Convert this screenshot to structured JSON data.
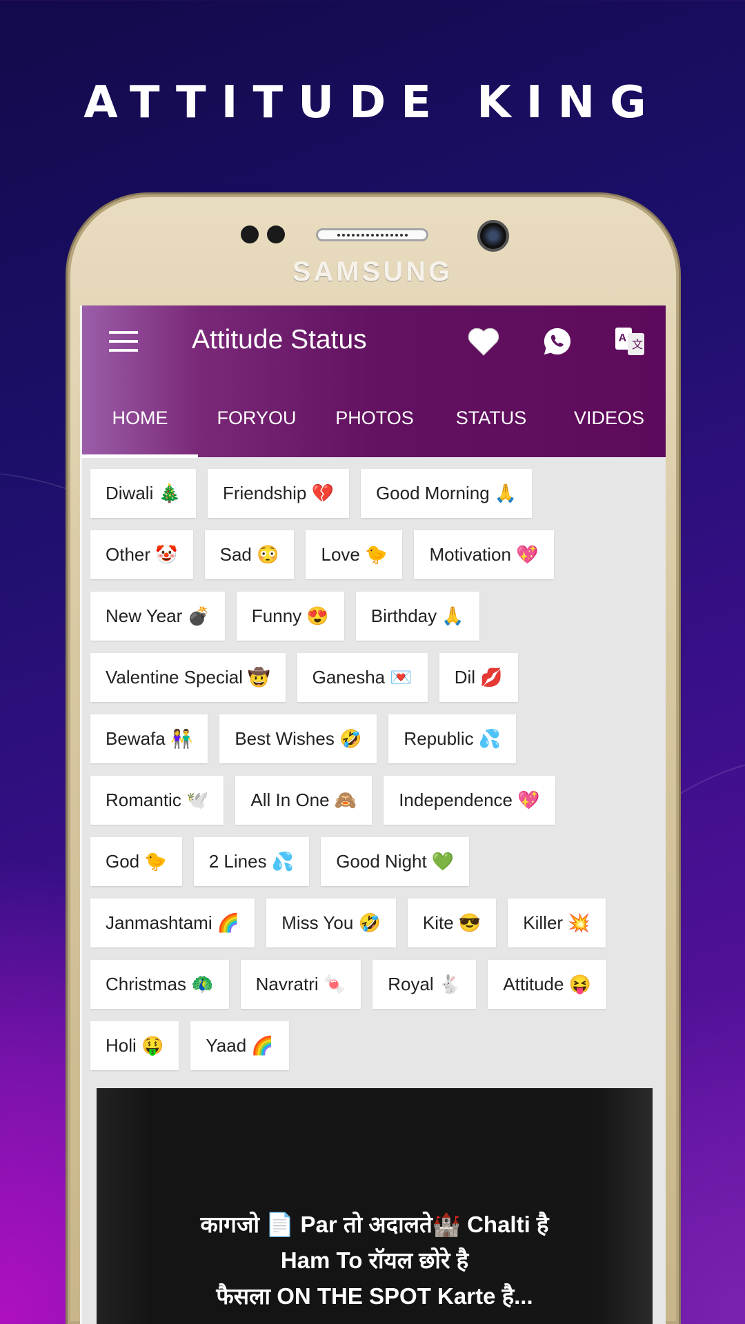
{
  "headline": "ATTITUDE KING",
  "device": {
    "brand": "SAMSUNG"
  },
  "appbar": {
    "title": "Attitude Status",
    "icons": [
      "menu-icon",
      "heart-icon",
      "whatsapp-icon",
      "translate-icon"
    ],
    "color": "#621260"
  },
  "tabs": [
    {
      "label": "HOME",
      "selected": true
    },
    {
      "label": "FORYOU"
    },
    {
      "label": "PHOTOS"
    },
    {
      "label": "STATUS"
    },
    {
      "label": "VIDEOS"
    }
  ],
  "categories": [
    [
      "Diwali 🎄",
      "Friendship 💔",
      "Good Morning 🙏"
    ],
    [
      "Other 🤡",
      "Sad 😳",
      "Love 🐤",
      "Motivation 💖"
    ],
    [
      "New Year 💣",
      "Funny 😍",
      "Birthday 🙏"
    ],
    [
      "Valentine Special 🤠",
      "Ganesha 💌",
      "Dil 💋"
    ],
    [
      "Bewafa 👫",
      "Best Wishes 🤣",
      "Republic 💦"
    ],
    [
      "Romantic 🕊️",
      "All In One 🙈",
      "Independence 💖"
    ],
    [
      "God 🐤",
      "2 Lines 💦",
      "Good Night 💚"
    ],
    [
      "Janmashtami 🌈",
      "Miss You 🤣",
      "Kite 😎",
      "Killer 💥"
    ],
    [
      "Christmas 🦚",
      "Navratri 🍬",
      "Royal 🐇",
      "Attitude 😝"
    ],
    [
      "Holi 🤑",
      "Yaad 🌈"
    ]
  ],
  "status_card": {
    "lines": [
      "कागजो 📄 Par तो अदालते🏰 Chalti है",
      "Ham To रॉयल छोरे है",
      "फैसला ON THE SPOT Karte है..."
    ]
  }
}
